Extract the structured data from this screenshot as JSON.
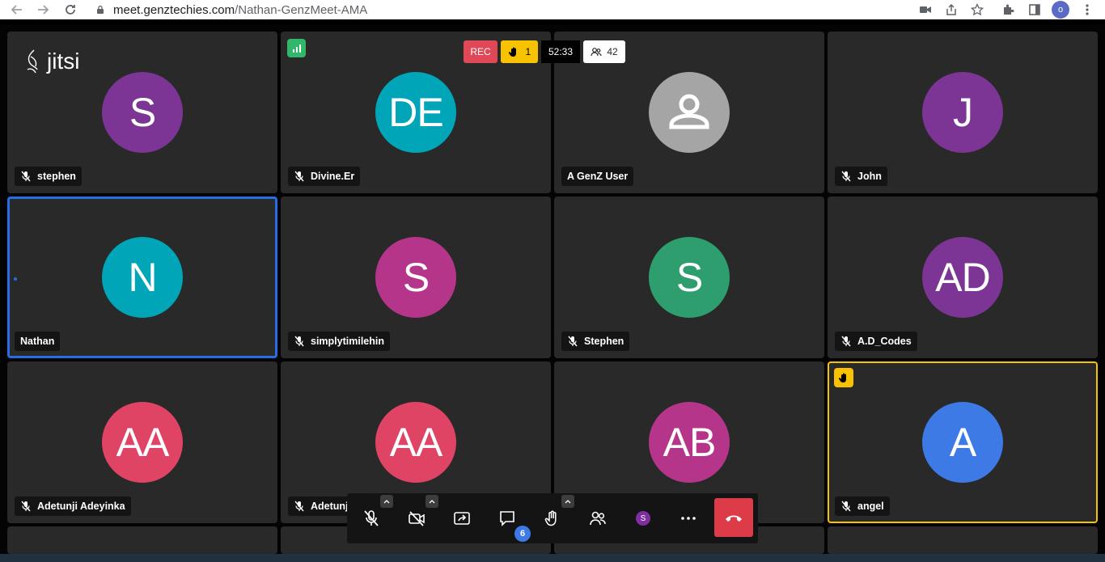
{
  "browser": {
    "url_host": "meet.genztechies.com",
    "url_path": "/Nathan-GenzMeet-AMA",
    "profile_initial": "o"
  },
  "branding": {
    "logo_text": "jitsi"
  },
  "indicators": {
    "rec_label": "REC",
    "raised_hands": "1",
    "timer": "52:33",
    "participant_count": "42"
  },
  "tiles": [
    {
      "name": "stephen",
      "initials": "S",
      "color": "#7c3595",
      "muted": true
    },
    {
      "name": "Divine.Er",
      "initials": "DE",
      "color": "#00a6b8",
      "muted": true
    },
    {
      "name": "A GenZ User",
      "initials": "",
      "color": "#a5a5a5",
      "muted": false
    },
    {
      "name": "John",
      "initials": "J",
      "color": "#7c3595",
      "muted": true
    },
    {
      "name": "Nathan",
      "initials": "N",
      "color": "#00a6b8",
      "muted": false
    },
    {
      "name": "simplytimilehin",
      "initials": "S",
      "color": "#b5358a",
      "muted": true
    },
    {
      "name": "Stephen",
      "initials": "S",
      "color": "#2e9e6f",
      "muted": true
    },
    {
      "name": "A.D_Codes",
      "initials": "AD",
      "color": "#7c3595",
      "muted": true
    },
    {
      "name": "Adetunji Adeyinka",
      "initials": "AA",
      "color": "#e04464",
      "muted": true
    },
    {
      "name": "Adetunji",
      "initials": "AA",
      "color": "#e04464",
      "muted": true
    },
    {
      "name": "",
      "initials": "AB",
      "color": "#b5358a",
      "muted": false
    },
    {
      "name": "angel",
      "initials": "A",
      "color": "#3d7ae5",
      "muted": true
    }
  ],
  "toolbar": {
    "chat_unread": "6",
    "self_initial": "S"
  }
}
